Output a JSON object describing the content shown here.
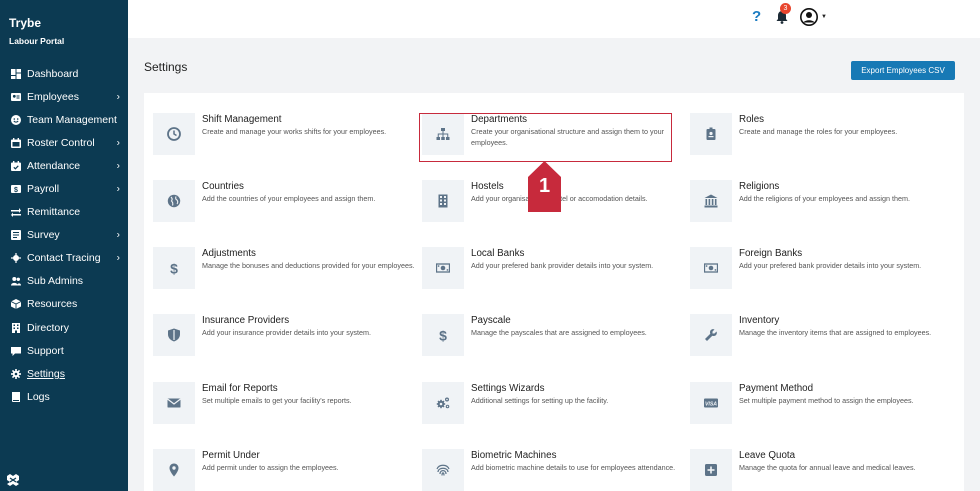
{
  "app": {
    "name": "Trybe",
    "portal": "Labour Portal"
  },
  "sidebar": {
    "items": [
      {
        "label": "Dashboard",
        "icon": "dashboard-icon",
        "chevron": false
      },
      {
        "label": "Employees",
        "icon": "employee-icon",
        "chevron": true
      },
      {
        "label": "Team Management",
        "icon": "smile-icon",
        "chevron": false
      },
      {
        "label": "Roster Control",
        "icon": "calendar-icon",
        "chevron": true
      },
      {
        "label": "Attendance",
        "icon": "calendar-check-icon",
        "chevron": true
      },
      {
        "label": "Payroll",
        "icon": "payroll-icon",
        "chevron": true
      },
      {
        "label": "Remittance",
        "icon": "exchange-icon",
        "chevron": false
      },
      {
        "label": "Survey",
        "icon": "survey-icon",
        "chevron": true
      },
      {
        "label": "Contact Tracing",
        "icon": "virus-icon",
        "chevron": true
      },
      {
        "label": "Sub Admins",
        "icon": "users-icon",
        "chevron": false
      },
      {
        "label": "Resources",
        "icon": "box-icon",
        "chevron": false
      },
      {
        "label": "Directory",
        "icon": "building-icon",
        "chevron": false
      },
      {
        "label": "Support",
        "icon": "chat-icon",
        "chevron": false
      },
      {
        "label": "Settings",
        "icon": "gear-icon",
        "chevron": false,
        "active": true
      },
      {
        "label": "Logs",
        "icon": "book-icon",
        "chevron": false
      }
    ]
  },
  "topbar": {
    "help": "?",
    "notifications_count": "3"
  },
  "header": {
    "title": "Settings",
    "export_label": "Export Employees CSV"
  },
  "tiles": [
    {
      "title": "Shift Management",
      "desc": "Create and manage your works shifts for your employees.",
      "icon": "clock-icon"
    },
    {
      "title": "Departments",
      "desc": "Create your organisational structure and assign them to your employees.",
      "icon": "sitemap-icon"
    },
    {
      "title": "Roles",
      "desc": "Create and manage the roles for your employees.",
      "icon": "id-badge-icon"
    },
    {
      "title": "Countries",
      "desc": "Add the countries of your employees and assign them.",
      "icon": "globe-icon"
    },
    {
      "title": "Hostels",
      "desc": "Add your organisational hostel or accomodation details.",
      "icon": "building-icon"
    },
    {
      "title": "Religions",
      "desc": "Add the religions of your employees and assign them.",
      "icon": "institution-icon"
    },
    {
      "title": "Adjustments",
      "desc": "Manage the bonuses and deductions provided for your employees.",
      "icon": "dollar-icon"
    },
    {
      "title": "Local Banks",
      "desc": "Add your prefered bank provider details into your system.",
      "icon": "money-icon"
    },
    {
      "title": "Foreign Banks",
      "desc": "Add your prefered bank provider details into your system.",
      "icon": "money-icon"
    },
    {
      "title": "Insurance Providers",
      "desc": "Add your insurance provider details into your system.",
      "icon": "shield-icon"
    },
    {
      "title": "Payscale",
      "desc": "Manage the payscales that are assigned to employees.",
      "icon": "dollar-icon"
    },
    {
      "title": "Inventory",
      "desc": "Manage the inventory items that are assigned to employees.",
      "icon": "wrench-icon"
    },
    {
      "title": "Email for Reports",
      "desc": "Set multiple emails to get your facility's reports.",
      "icon": "envelope-icon"
    },
    {
      "title": "Settings Wizards",
      "desc": "Additional settings for setting up the facility.",
      "icon": "cogs-icon"
    },
    {
      "title": "Payment Method",
      "desc": "Set multiple payment method to assign the employees.",
      "icon": "visa-icon"
    },
    {
      "title": "Permit Under",
      "desc": "Add permit under to assign the employees.",
      "icon": "map-marker-icon"
    },
    {
      "title": "Biometric Machines",
      "desc": "Add biometric machine details to use for employees attendance.",
      "icon": "fingerprint-icon"
    },
    {
      "title": "Leave Quota",
      "desc": "Manage the quota for annual leave and medical leaves.",
      "icon": "plus-square-icon"
    }
  ],
  "annotation": {
    "step": "1"
  },
  "colors": {
    "sidebar": "#0c3a52",
    "accent": "#1779b5",
    "highlight": "#c72a3c",
    "badge": "#e8452e"
  }
}
